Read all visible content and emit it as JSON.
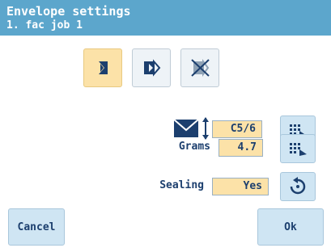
{
  "header": {
    "title": "Envelope settings",
    "subtitle": "1. fac job 1"
  },
  "orientation_modes": [
    {
      "icon": "envelope-flap-left-icon",
      "selected": true
    },
    {
      "icon": "envelope-flap-right-icon",
      "selected": false
    },
    {
      "icon": "envelope-crossed-icon",
      "selected": false
    }
  ],
  "envelope_size": {
    "icon": "envelope-size-icon",
    "value": "C5/6"
  },
  "grams": {
    "label": "Grams",
    "value": "4.7"
  },
  "sealing": {
    "label": "Sealing",
    "value": "Yes"
  },
  "side_buttons": {
    "edit_icon": "edit-size-icon",
    "toggle_icon": "rotate-icon"
  },
  "buttons": {
    "cancel": "Cancel",
    "ok": "Ok"
  },
  "colors": {
    "header": "#5ca6cc",
    "accent": "#fce2a8",
    "button": "#cfe5f3"
  }
}
